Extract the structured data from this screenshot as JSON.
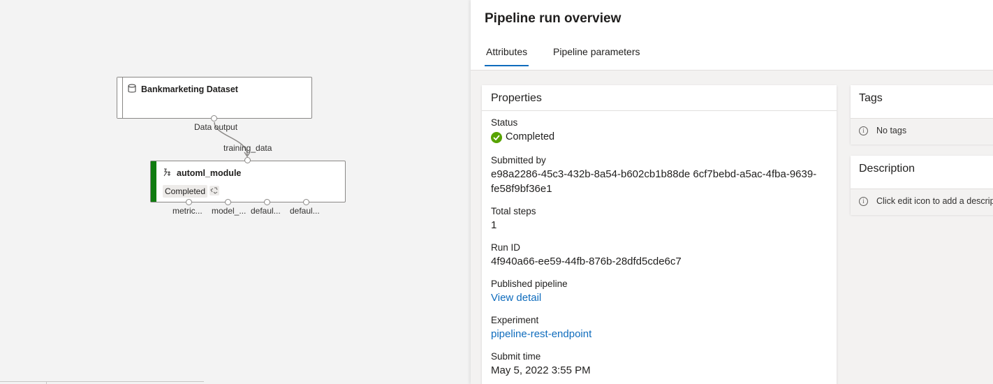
{
  "canvas": {
    "dataset_node": {
      "title": "Bankmarketing Dataset",
      "output_label": "Data output"
    },
    "automl_node": {
      "title": "automl_module",
      "status": "Completed",
      "input_label": "training_data",
      "output_labels": [
        "metric...",
        "model_...",
        "defaul...",
        "defaul..."
      ]
    },
    "colors": {
      "success_bar": "#107c10"
    }
  },
  "panel": {
    "title": "Pipeline run overview",
    "tabs": [
      {
        "label": "Attributes",
        "selected": true
      },
      {
        "label": "Pipeline parameters",
        "selected": false
      }
    ],
    "properties": {
      "heading": "Properties",
      "status_label": "Status",
      "status_value": "Completed",
      "submitted_by_label": "Submitted by",
      "submitted_by_value": "e98a2286-45c3-432b-8a54-b602cb1b88de 6cf7bebd-a5ac-4fba-9639-fe58f9bf36e1",
      "total_steps_label": "Total steps",
      "total_steps_value": "1",
      "run_id_label": "Run ID",
      "run_id_value": "4f940a66-ee59-44fb-876b-28dfd5cde6c7",
      "published_pipeline_label": "Published pipeline",
      "published_pipeline_value": "View detail",
      "experiment_label": "Experiment",
      "experiment_value": "pipeline-rest-endpoint",
      "submit_time_label": "Submit time",
      "submit_time_value": "May 5, 2022 3:55 PM"
    },
    "tags": {
      "heading": "Tags",
      "empty_text": "No tags"
    },
    "description": {
      "heading": "Description",
      "placeholder": "Click edit icon to add a descripti"
    },
    "colors": {
      "link": "#0f6cbd",
      "success": "#57a300",
      "tab_underline": "#0f6cbd"
    }
  }
}
